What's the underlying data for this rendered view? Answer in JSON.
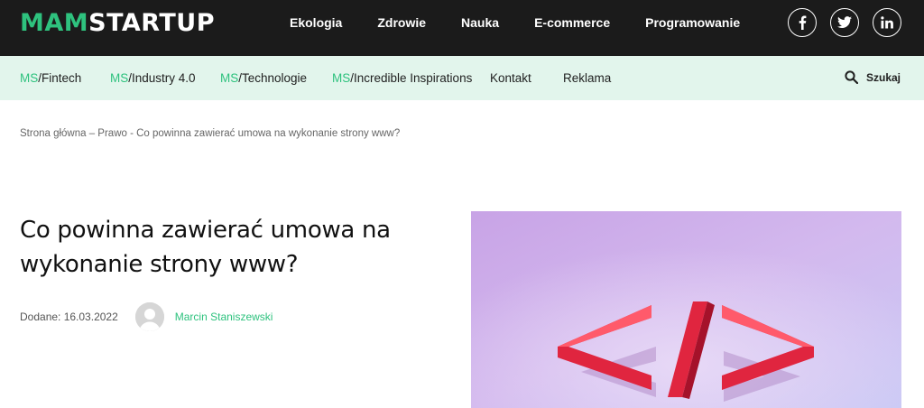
{
  "logo": {
    "part1": "MAM",
    "part2": "STARTUP"
  },
  "top_nav": [
    "Ekologia",
    "Zdrowie",
    "Nauka",
    "E-commerce",
    "Programowanie"
  ],
  "social": [
    "facebook-icon",
    "twitter-icon",
    "linkedin-icon"
  ],
  "sub_nav": [
    {
      "prefix": "MS",
      "label": "/Fintech"
    },
    {
      "prefix": "MS",
      "label": "/Industry 4.0"
    },
    {
      "prefix": "MS",
      "label": "/Technologie"
    },
    {
      "prefix": "MS",
      "label": "/Incredible Inspirations"
    },
    {
      "prefix": "",
      "label": "Kontakt"
    },
    {
      "prefix": "",
      "label": "Reklama"
    }
  ],
  "search": {
    "label": "Szukaj"
  },
  "breadcrumb": "Strona główna – Prawo - Co powinna zawierać umowa na wykonanie strony www?",
  "article": {
    "title": "Co powinna zawierać umowa na wykonanie strony www?",
    "date_label": "Dodane: 16.03.2022",
    "author": "Marcin Staniszewski"
  },
  "colors": {
    "accent": "#2ec27e",
    "topbar": "#1b1b1b",
    "subnav_bg": "#e2f5ec"
  }
}
